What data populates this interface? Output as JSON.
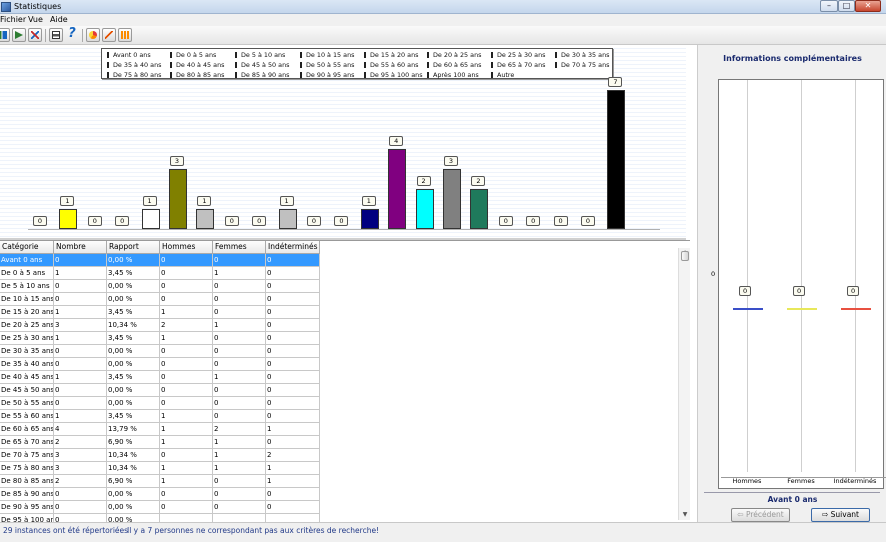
{
  "window": {
    "title": "Statistiques"
  },
  "menu": [
    "Fichier",
    "Vue",
    "Aide"
  ],
  "window_buttons": {
    "minimize": "–",
    "maximize": "□",
    "close": "✕"
  },
  "legend": [
    [
      "Avant 0 ans",
      "De 0 à 5 ans",
      "De 5 à 10 ans",
      "De 10 à 15 ans",
      "De 15 à 20 ans",
      "De 20 à 25 ans",
      "De 25 à 30 ans",
      "De 30 à 35 ans"
    ],
    [
      "De 35 à 40 ans",
      "De 40 à 45 ans",
      "De 45 à 50 ans",
      "De 50 à 55 ans",
      "De 55 à 60 ans",
      "De 60 à 65 ans",
      "De 65 à 70 ans",
      "De 70 à 75 ans"
    ],
    [
      "De 75 à 80 ans",
      "De 80 à 85 ans",
      "De 85 à 90 ans",
      "De 90 à 95 ans",
      "De 95 à 100 ans",
      "Après 100 ans",
      "Autre",
      ""
    ]
  ],
  "chart_data": {
    "type": "bar",
    "values": [
      0,
      1,
      0,
      0,
      1,
      3,
      1,
      0,
      0,
      1,
      0,
      0,
      1,
      4,
      2,
      3,
      2,
      0,
      0,
      0,
      0,
      7
    ],
    "colors": [
      "#ffffff",
      "#ffff00",
      "#ffffff",
      "#ffffff",
      "#ffffff",
      "#808000",
      "#c0c0c0",
      "#ffffff",
      "#ffffff",
      "#c0c0c0",
      "#ffffff",
      "#ffffff",
      "#000080",
      "#800080",
      "#00ffff",
      "#808080",
      "#1f7a5c",
      "#ffffff",
      "#ffffff",
      "#ffffff",
      "#ffffff",
      "#000000"
    ]
  },
  "table": {
    "columns": [
      "Catégorie",
      "Nombre",
      "Rapport",
      "Hommes",
      "Femmes",
      "Indéterminés"
    ],
    "rows": [
      [
        "Avant 0 ans",
        "0",
        "0,00 %",
        "0",
        "0",
        "0"
      ],
      [
        "De 0 à 5 ans",
        "1",
        "3,45 %",
        "0",
        "1",
        "0"
      ],
      [
        "De 5 à 10 ans",
        "0",
        "0,00 %",
        "0",
        "0",
        "0"
      ],
      [
        "De 10 à 15 ans",
        "0",
        "0,00 %",
        "0",
        "0",
        "0"
      ],
      [
        "De 15 à 20 ans",
        "1",
        "3,45 %",
        "1",
        "0",
        "0"
      ],
      [
        "De 20 à 25 ans",
        "3",
        "10,34 %",
        "2",
        "1",
        "0"
      ],
      [
        "De 25 à 30 ans",
        "1",
        "3,45 %",
        "1",
        "0",
        "0"
      ],
      [
        "De 30 à 35 ans",
        "0",
        "0,00 %",
        "0",
        "0",
        "0"
      ],
      [
        "De 35 à 40 ans",
        "0",
        "0,00 %",
        "0",
        "0",
        "0"
      ],
      [
        "De 40 à 45 ans",
        "1",
        "3,45 %",
        "0",
        "1",
        "0"
      ],
      [
        "De 45 à 50 ans",
        "0",
        "0,00 %",
        "0",
        "0",
        "0"
      ],
      [
        "De 50 à 55 ans",
        "0",
        "0,00 %",
        "0",
        "0",
        "0"
      ],
      [
        "De 55 à 60 ans",
        "1",
        "3,45 %",
        "1",
        "0",
        "0"
      ],
      [
        "De 60 à 65 ans",
        "4",
        "13,79 %",
        "1",
        "2",
        "1"
      ],
      [
        "De 65 à 70 ans",
        "2",
        "6,90 %",
        "1",
        "1",
        "0"
      ],
      [
        "De 70 à 75 ans",
        "3",
        "10,34 %",
        "0",
        "1",
        "2"
      ],
      [
        "De 75 à 80 ans",
        "3",
        "10,34 %",
        "1",
        "1",
        "1"
      ],
      [
        "De 80 à 85 ans",
        "2",
        "6,90 %",
        "1",
        "0",
        "1"
      ],
      [
        "De 85 à 90 ans",
        "0",
        "0,00 %",
        "0",
        "0",
        "0"
      ],
      [
        "De 90 à 95 ans",
        "0",
        "0,00 %",
        "0",
        "0",
        "0"
      ],
      [
        "De 95 à 100 ans",
        "0",
        "0,00 %",
        "",
        "",
        ""
      ]
    ]
  },
  "side_panel": {
    "title": "Informations complémentaires",
    "zero_tick": "0",
    "categories": [
      "Hommes",
      "Femmes",
      "Indéterminés"
    ],
    "values": [
      "0",
      "0",
      "0"
    ],
    "line_colors": [
      "#3a4fc8",
      "#e8e85a",
      "#e85040"
    ],
    "current_category": "Avant 0 ans",
    "prev_label": "Précédent",
    "next_label": "Suivant"
  },
  "status": {
    "count_text": "29 instances ont été répertoriées",
    "message": "Il y a 7 personnes ne correspondant pas aux critères de recherche!"
  },
  "toolbar_icons": [
    "chart-icon",
    "export-icon",
    "close-icon",
    "print-icon",
    "help-icon",
    "pie-chart-icon",
    "line-chart-icon",
    "bar-chart-icon"
  ]
}
